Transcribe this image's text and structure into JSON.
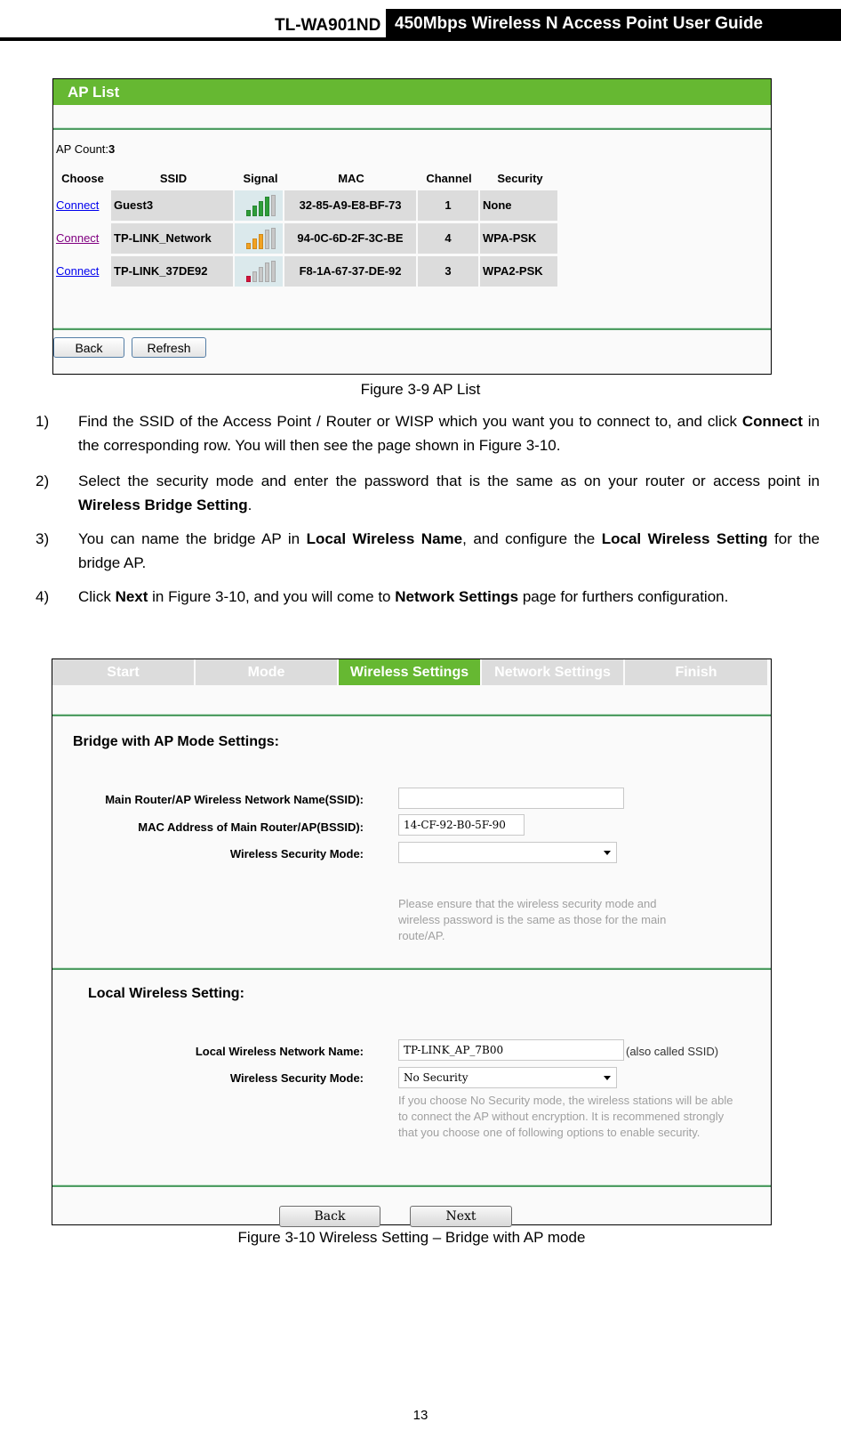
{
  "header": {
    "model": "TL-WA901ND",
    "guide_title": "450Mbps Wireless N Access Point User Guide"
  },
  "figure1": {
    "title": "AP List",
    "ap_count_label": "AP Count:",
    "ap_count_value": "3",
    "columns": [
      "Choose",
      "SSID",
      "Signal",
      "MAC",
      "Channel",
      "Security"
    ],
    "rows": [
      {
        "action": "Connect",
        "ssid": "Guest3",
        "signal_bars": 4,
        "signal_color": "#2e9e3a",
        "mac": "32-85-A9-E8-BF-73",
        "channel": "1",
        "security": "None",
        "visited": false
      },
      {
        "action": "Connect",
        "ssid": "TP-LINK_Network",
        "signal_bars": 3,
        "signal_color": "#f2a222",
        "mac": "94-0C-6D-2F-3C-BE",
        "channel": "4",
        "security": "WPA-PSK",
        "visited": true
      },
      {
        "action": "Connect",
        "ssid": "TP-LINK_37DE92",
        "signal_bars": 1,
        "signal_color": "#d4143c",
        "mac": "F8-1A-67-37-DE-92",
        "channel": "3",
        "security": "WPA2-PSK",
        "visited": false
      }
    ],
    "buttons": {
      "back": "Back",
      "refresh": "Refresh"
    },
    "caption": "Figure 3-9 AP List"
  },
  "instructions": [
    {
      "num": "1)",
      "parts": [
        {
          "t": "Find the SSID of the Access Point / Router or WISP which you want you to connect to, and click "
        },
        {
          "b": "Connect"
        },
        {
          "t": " in the corresponding row. You will then see the page shown in Figure 3-10."
        }
      ]
    },
    {
      "num": "2)",
      "parts": [
        {
          "t": "Select the security mode and enter the password that is the same as on your router or access point in "
        },
        {
          "b": "Wireless Bridge Setting"
        },
        {
          "t": "."
        }
      ]
    },
    {
      "num": "3)",
      "parts": [
        {
          "t": "You can name the bridge AP in "
        },
        {
          "b": "Local Wireless Name"
        },
        {
          "t": ", and configure the "
        },
        {
          "b": "Local Wireless Setting"
        },
        {
          "t": " for the bridge AP."
        }
      ]
    },
    {
      "num": "4)",
      "parts": [
        {
          "t": "Click "
        },
        {
          "b": "Next"
        },
        {
          "t": " in Figure 3-10, and you will come to "
        },
        {
          "b": "Network Settings"
        },
        {
          "t": " page for furthers configuration."
        }
      ]
    }
  ],
  "figure2": {
    "steps": [
      "Start",
      "Mode",
      "Wireless Settings",
      "Network Settings",
      "Finish"
    ],
    "active_step": "Wireless Settings",
    "bridge_section": {
      "title": "Bridge with AP Mode Settings:",
      "ssid_label": "Main Router/AP Wireless Network Name(SSID):",
      "ssid_value": "",
      "bssid_label": "MAC Address of Main Router/AP(BSSID):",
      "bssid_value": "14-CF-92-B0-5F-90",
      "security_label": "Wireless Security Mode:",
      "security_value": "",
      "note": "Please ensure that the wireless security mode and wireless password is the same as those for the main route/AP."
    },
    "local_section": {
      "title": "Local Wireless Setting:",
      "name_label": "Local Wireless Network Name:",
      "name_value": "TP-LINK_AP_7B00",
      "name_hint": "(also called SSID)",
      "security_label": "Wireless Security Mode:",
      "security_value": "No Security",
      "note": "If you choose No Security mode, the wireless stations will be able to connect the AP without encryption. It is recommened strongly that you choose one of following options to enable security."
    },
    "buttons": {
      "back": "Back",
      "next": "Next"
    },
    "caption": "Figure 3-10 Wireless Setting – Bridge with AP mode"
  },
  "page_number": "13"
}
